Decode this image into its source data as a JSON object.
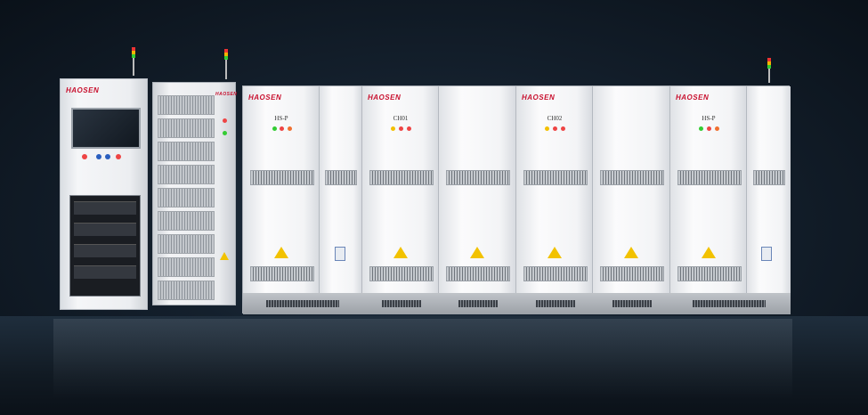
{
  "scene": {
    "brand": "HAOSEN",
    "station": {
      "brand": "HAOSEN"
    },
    "rack": {
      "brand": "HAOSEN"
    },
    "main_cabinet": {
      "sections": [
        {
          "brand": "HAOSEN",
          "label": "HS-P"
        },
        {
          "brand": "HAOSEN",
          "label": "CH01"
        },
        {
          "brand": "HAOSEN",
          "label": "CH02"
        },
        {
          "brand": "HAOSEN",
          "label": "HS-P"
        }
      ]
    }
  },
  "colors": {
    "brand_red": "#c8102e",
    "cabinet_white": "#f3f4f6",
    "warning_yellow": "#f2c200",
    "background_dark": "#0a1119"
  }
}
